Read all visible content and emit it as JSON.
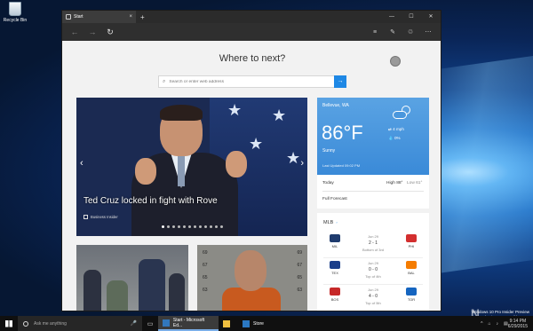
{
  "desktop": {
    "recycle_bin_label": "Recycle Bin",
    "watermark": {
      "line1": "Windows 10 Pro Insider Preview",
      "line2": "Evaluation copy. Build 10158",
      "brand": "N"
    }
  },
  "browser": {
    "tab": {
      "title": "Start",
      "close": "×"
    },
    "new_tab": "+",
    "window_controls": {
      "minimize": "—",
      "maximize": "☐",
      "close": "✕"
    },
    "nav": {
      "back": "←",
      "forward": "→",
      "refresh": "↻"
    }
  },
  "start_page": {
    "heading": "Where to next?",
    "search_placeholder": "Search or enter web address",
    "hero": {
      "title": "Ted Cruz locked in fight with Rove",
      "source": "Business Insider",
      "prev": "‹",
      "next": "›",
      "dot_count": 12,
      "active_dot": 0
    },
    "weather": {
      "location": "Bellevue, WA",
      "temperature": "86°F",
      "condition": "Sunny",
      "wind": "4 mph",
      "precip": "0%",
      "updated": "Last Updated 09:02 PM",
      "today_label": "Today",
      "high": "High 88°",
      "low": "Low 61°",
      "forecast_link": "Full Forecast"
    },
    "mlb": {
      "title": "MLB",
      "games": [
        {
          "home": "MIL",
          "away": "PHI",
          "date": "Jun 29",
          "score": "2 - 1",
          "status": "Bottom of 3rd",
          "home_color": "#1f3b6e",
          "away_color": "#d32f2f"
        },
        {
          "home": "TEX",
          "away": "BAL",
          "date": "Jun 29",
          "score": "0 - 0",
          "status": "Top of 4th",
          "home_color": "#1b3f8b",
          "away_color": "#f57c00"
        },
        {
          "home": "BOS",
          "away": "TOR",
          "date": "Jun 29",
          "score": "4 - 0",
          "status": "Top of 5th",
          "home_color": "#c62828",
          "away_color": "#1565c0"
        }
      ]
    }
  },
  "taskbar": {
    "cortana_placeholder": "Ask me anything",
    "apps": [
      {
        "label": "Start - Microsoft Ed...",
        "icon": "edge-icon",
        "color": "#3277bc"
      },
      {
        "label": "",
        "icon": "explorer-icon",
        "color": "#f0c040"
      },
      {
        "label": "Store",
        "icon": "store-icon",
        "color": "#2b78c2"
      }
    ],
    "time": "9:14 PM",
    "date": "6/29/2015"
  }
}
